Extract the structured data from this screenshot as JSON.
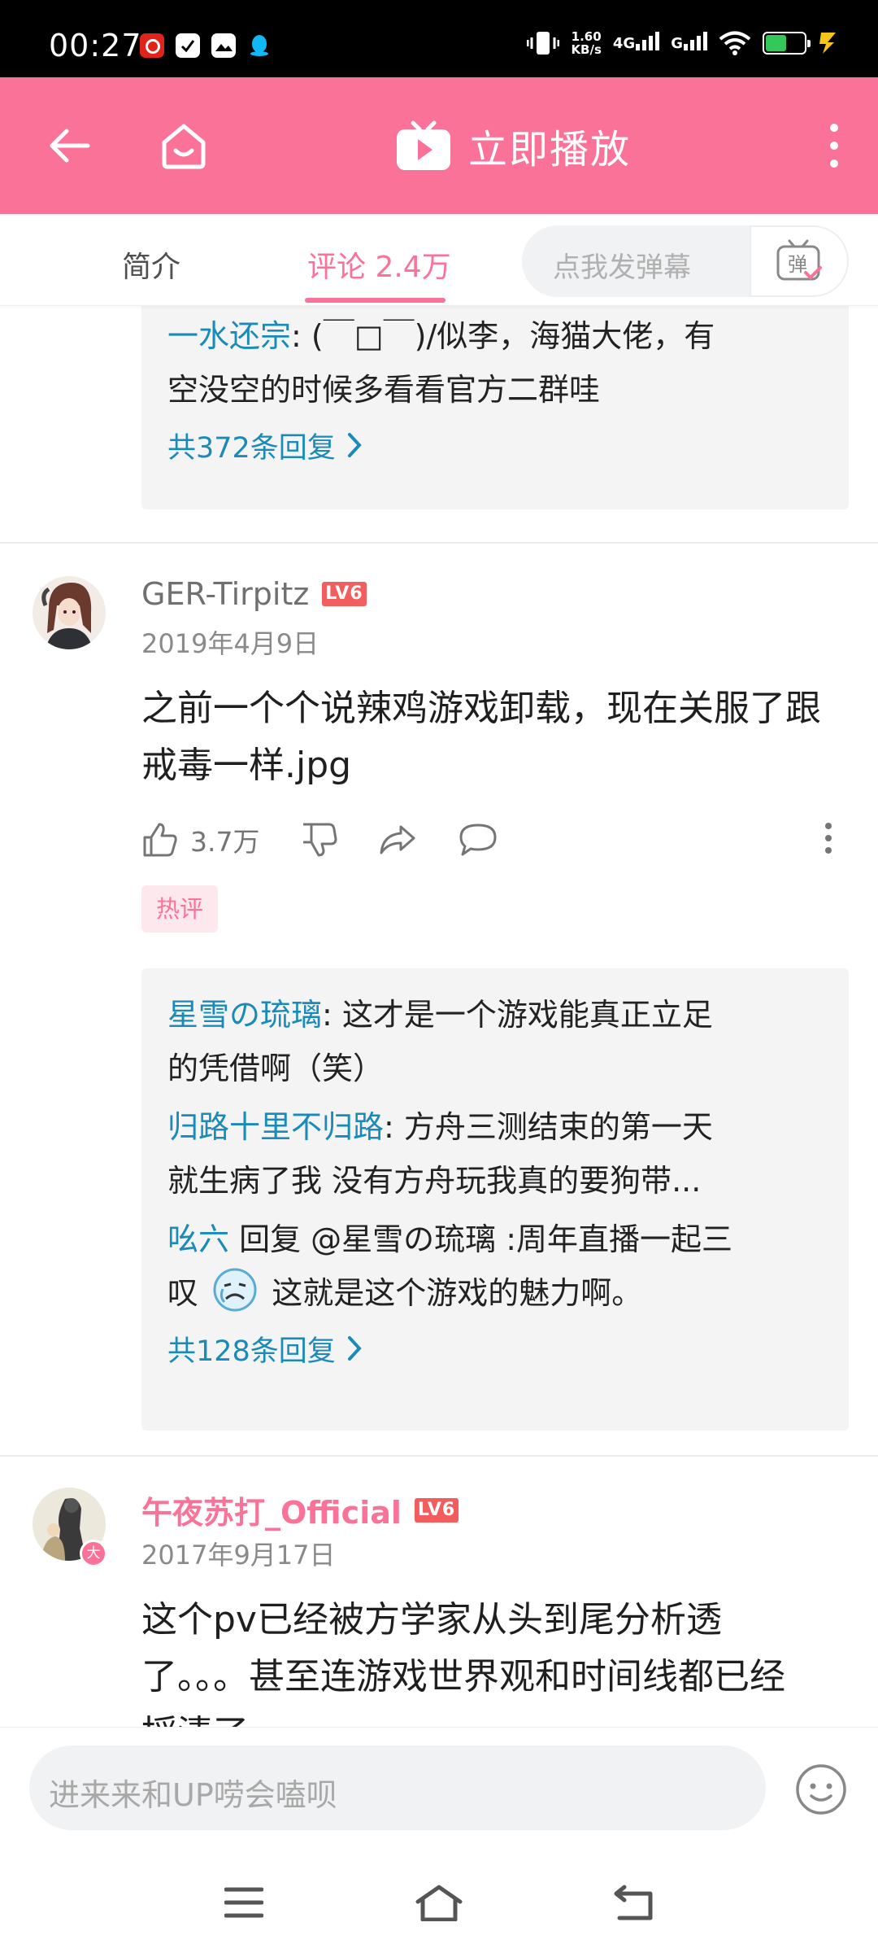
{
  "status_bar": {
    "time": "00:27",
    "speed_value": "1.60",
    "speed_unit": "KB/s",
    "network": "4G",
    "network2": "G"
  },
  "header": {
    "title": "立即播放"
  },
  "tabs": {
    "intro": "简介",
    "comments": "评论 2.4万",
    "danmaku_placeholder": "点我发弹幕",
    "danmaku_icon_label": "弹"
  },
  "thread0": {
    "reply_name": "一水还宗",
    "reply_text_1": ": (￣□￣)/似李，海猫大佬，有",
    "reply_text_2": "空没空的时候多看看官方二群哇",
    "more_replies": "共372条回复"
  },
  "comment1": {
    "username": "GER-Tirpitz",
    "level": "LV6",
    "date": "2019年4月9日",
    "text_1": "之前一个个说辣鸡游戏卸载，现在关服了跟",
    "text_2": "戒毒一样.jpg",
    "likes": "3.7万",
    "tag": "热评",
    "replies": [
      {
        "name": "星雪の琉璃",
        "line1": ": 这才是一个游戏能真正立足",
        "line2": "的凭借啊（笑）"
      },
      {
        "name": "归路十里不归路",
        "line1": ": 方舟三测结束的第一天",
        "line2": "就生病了我 没有方舟玩我真的要狗带..."
      }
    ],
    "reply3_name": "吆六",
    "reply3_line1": " 回复 @星雪の琉璃 :周年直播一起三",
    "reply3_prefix": "叹",
    "reply3_suffix": "这就是这个游戏的魅力啊。",
    "more_replies": "共128条回复"
  },
  "comment2": {
    "username": "午夜苏打_Official",
    "level": "LV6",
    "badge": "大",
    "date": "2017年9月17日",
    "text_1": "这个pv已经被方学家从头到尾分析透",
    "text_2": "了。。。甚至连游戏世界观和时间线都已经",
    "text_3": "捋清了"
  },
  "input": {
    "placeholder": "进来来和UP唠会嗑呗"
  },
  "colors": {
    "brand_pink": "#fb7299",
    "link_blue": "#1a8bb8",
    "level_red": "#f25d5d"
  }
}
